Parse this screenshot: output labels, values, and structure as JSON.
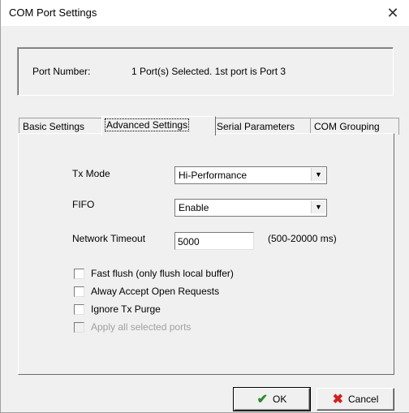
{
  "window": {
    "title": "COM Port Settings"
  },
  "port": {
    "label": "Port Number:",
    "value": "1 Port(s) Selected. 1st port is Port 3"
  },
  "tabs": [
    {
      "label": "Basic Settings",
      "active": false
    },
    {
      "label": "Advanced Settings",
      "active": true
    },
    {
      "label": "Serial Parameters",
      "active": false
    },
    {
      "label": "COM Grouping",
      "active": false
    }
  ],
  "advanced": {
    "tx_mode": {
      "label": "Tx Mode",
      "value": "Hi-Performance"
    },
    "fifo": {
      "label": "FIFO",
      "value": "Enable"
    },
    "network_timeout": {
      "label": "Network Timeout",
      "value": "5000",
      "range": "(500-20000 ms)"
    },
    "checkboxes": [
      {
        "label": "Fast flush (only flush local buffer)",
        "checked": false,
        "enabled": true
      },
      {
        "label": "Alway Accept Open Requests",
        "checked": false,
        "enabled": true
      },
      {
        "label": "Ignore Tx Purge",
        "checked": false,
        "enabled": true
      },
      {
        "label": "Apply all selected ports",
        "checked": false,
        "enabled": false
      }
    ]
  },
  "buttons": {
    "ok": "OK",
    "cancel": "Cancel"
  },
  "icons": {
    "close": "close-icon",
    "ok": "check-icon",
    "cancel": "x-icon",
    "dropdown": "chevron-down-icon"
  },
  "colors": {
    "ok_icon": "#2a8a2a",
    "cancel_icon": "#d02020",
    "disabled_text": "#a0a0a0"
  }
}
